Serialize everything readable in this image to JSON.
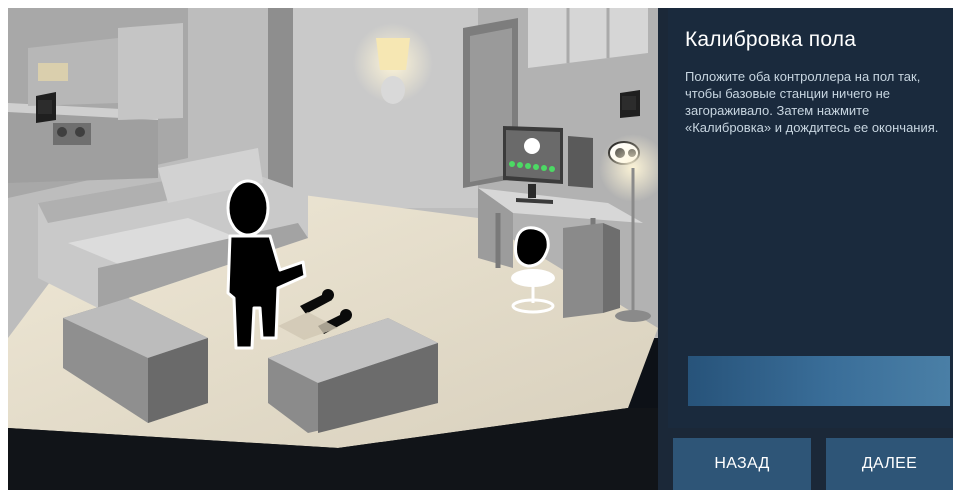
{
  "panel": {
    "title": "Калибровка пола",
    "instructions": "Положите оба контроллера на пол так, чтобы базовые станции ничего не загораживало. Затем нажмите «Калибровка» и дождитесь ее окончания."
  },
  "calibration_progress": 0,
  "buttons": {
    "back_label": "НАЗАД",
    "next_label": "ДАЛЕЕ"
  },
  "colors": {
    "panel_background": "#1a2a3d",
    "button_background": "#2e5577",
    "progress_fill": "#3a6e99",
    "status_led": "#4cd964"
  },
  "illustration": {
    "elements": [
      "room",
      "kitchen",
      "sofa",
      "coffee-table",
      "ottoman",
      "user-silhouette",
      "vr-controller",
      "vr-controller",
      "desk",
      "monitor",
      "pc-tower",
      "chair",
      "vr-headset",
      "floor-lamp",
      "table-lamp",
      "base-station",
      "base-station",
      "doorway",
      "window"
    ]
  }
}
